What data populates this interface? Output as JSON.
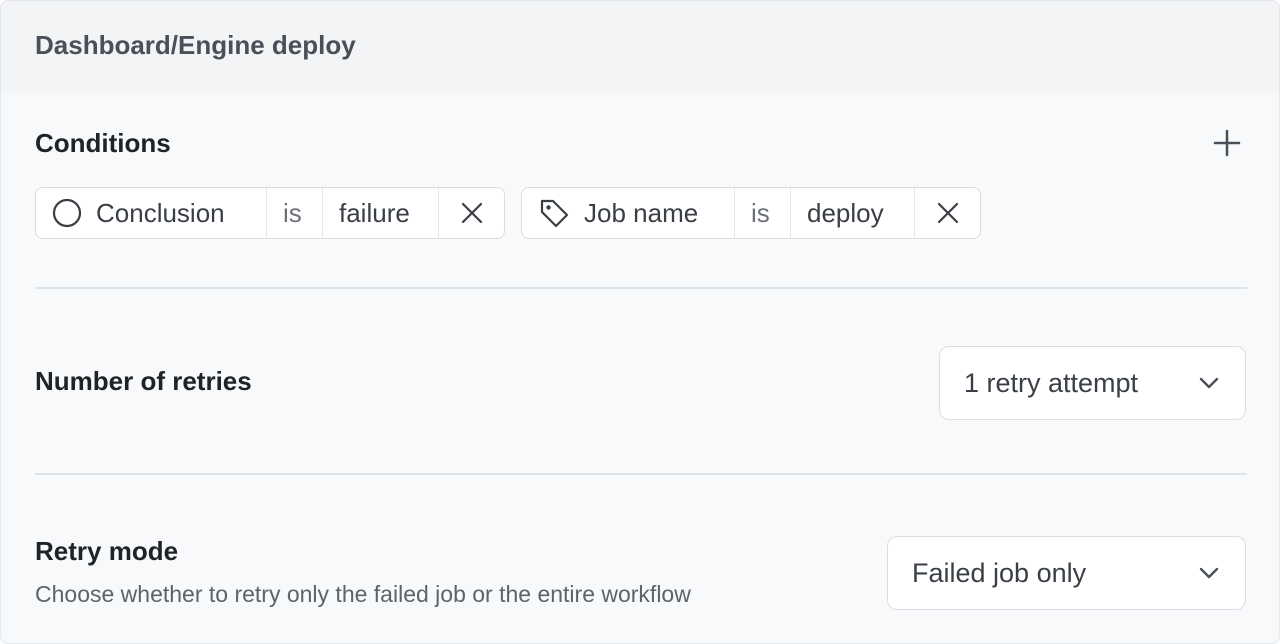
{
  "header": {
    "title": "Dashboard/Engine deploy"
  },
  "conditions": {
    "title": "Conditions",
    "add_icon": "plus-icon",
    "items": [
      {
        "icon": "circle-icon",
        "field": "Conclusion",
        "operator": "is",
        "value": "failure",
        "remove_icon": "x-icon"
      },
      {
        "icon": "tag-icon",
        "field": "Job name",
        "operator": "is",
        "value": "deploy",
        "remove_icon": "x-icon"
      }
    ]
  },
  "retries": {
    "title": "Number of retries",
    "selected": "1 retry attempt",
    "dropdown_icon": "chevron-down-icon"
  },
  "retry_mode": {
    "title": "Retry mode",
    "description": "Choose whether to retry only the failed job or the entire workflow",
    "selected": "Failed job only",
    "dropdown_icon": "chevron-down-icon"
  }
}
